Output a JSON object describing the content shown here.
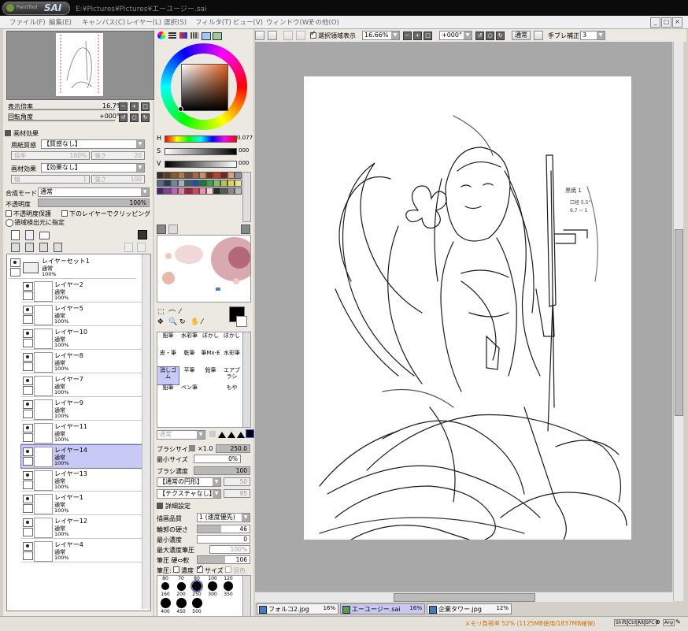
{
  "titlebar": {
    "logo_small": "PaintTool",
    "logo_text": "SAI",
    "path": "E:¥Pictures¥Pictures¥エーユージー.sai"
  },
  "menu": [
    "ファイル(F)",
    "編集(E)",
    "キャンバス(C)",
    "レイヤー(L)",
    "選択(S)",
    "フィルタ(T)",
    "ビュー(V)",
    "ウィンドウ(W)",
    "その他(O)"
  ],
  "window_buttons": [
    "_",
    "□",
    "×"
  ],
  "navigator": {
    "zoom_label": "表示倍率",
    "zoom_value": "16.7%",
    "rotation_label": "回転角度",
    "rotation_value": "+000°"
  },
  "paper_effects": {
    "header": "画材効果",
    "texture_label": "用紙質感",
    "texture_value": "【質感なし】",
    "texture_scale_label": "倍率",
    "texture_scale_value": "100%",
    "texture_strength_label": "強さ",
    "texture_strength_value": "20",
    "effect_label": "画材効果",
    "effect_value": "【効果なし】",
    "effect_width_label": "幅",
    "effect_width_value": "1",
    "effect_strength_label": "強さ",
    "effect_strength_value": "100"
  },
  "layer_settings": {
    "blend_label": "合成モード",
    "blend_value": "通常",
    "opacity_label": "不透明度",
    "opacity_value": "100%",
    "preserve_opacity": "不透明度保護",
    "clip_lower": "下のレイヤーでクリッピング",
    "selection_source": "領域検出元に指定"
  },
  "layers": [
    {
      "name": "レイヤーセット1",
      "mode": "通常",
      "opacity": "100%",
      "folder": true,
      "visible": true,
      "selected": false
    },
    {
      "name": "レイヤー2",
      "mode": "通常",
      "opacity": "100%",
      "visible": true,
      "selected": false
    },
    {
      "name": "レイヤー5",
      "mode": "通常",
      "opacity": "100%",
      "visible": true,
      "selected": false
    },
    {
      "name": "レイヤー10",
      "mode": "通常",
      "opacity": "100%",
      "visible": true,
      "selected": false
    },
    {
      "name": "レイヤー8",
      "mode": "通常",
      "opacity": "100%",
      "visible": true,
      "selected": false
    },
    {
      "name": "レイヤー7",
      "mode": "通常",
      "opacity": "100%",
      "visible": true,
      "selected": false
    },
    {
      "name": "レイヤー9",
      "mode": "通常",
      "opacity": "100%",
      "visible": true,
      "selected": false
    },
    {
      "name": "レイヤー11",
      "mode": "通常",
      "opacity": "100%",
      "visible": false,
      "selected": false
    },
    {
      "name": "レイヤー14",
      "mode": "通常",
      "opacity": "100%",
      "visible": true,
      "selected": true
    },
    {
      "name": "レイヤー13",
      "mode": "通常",
      "opacity": "100%",
      "visible": true,
      "selected": false
    },
    {
      "name": "レイヤー1",
      "mode": "通常",
      "opacity": "100%",
      "visible": false,
      "selected": false
    },
    {
      "name": "レイヤー12",
      "mode": "通常",
      "opacity": "100%",
      "visible": false,
      "selected": false
    },
    {
      "name": "レイヤー4",
      "mode": "通常",
      "opacity": "100%",
      "visible": true,
      "selected": false
    }
  ],
  "color": {
    "h_label": "H",
    "h_value": "0.077",
    "s_label": "S",
    "s_value": "000",
    "v_label": "V",
    "v_value": "000"
  },
  "swatches": [
    "#3a2a1f",
    "#5a3a22",
    "#8a5a2a",
    "#b07a3a",
    "#6a4a3a",
    "#a06a4a",
    "#c89060",
    "#7a2a1a",
    "#c04020",
    "#802020",
    "#e0a080",
    "#9090a0",
    "#5a6a8a",
    "#2a3a5a",
    "#6a8aa0",
    "#a0b0c0",
    "#3a5a7a",
    "#2050a0",
    "#1a7a3a",
    "#40a050",
    "#80c070",
    "#c0c040",
    "#e0d060",
    "#f0e090",
    "#502070",
    "#8040a0",
    "#c060c0",
    "#e080a0",
    "#a02040",
    "#e04060",
    "#f090b0",
    "#ffd0d0",
    "#2a2a2a",
    "#5a5a5a",
    "#8a8a8a",
    "#bababa"
  ],
  "tools": [
    {
      "label": "鉛筆"
    },
    {
      "label": "水彩筆"
    },
    {
      "label": "ぼかし"
    },
    {
      "label": "消しゴム"
    },
    {
      "label": "筆"
    },
    {
      "label": "鉛筆"
    },
    {
      "label": "エアブラシ"
    },
    {
      "label": "鉛筆"
    },
    {
      "label": "ペン"
    },
    {
      "label": "もや"
    }
  ],
  "tool_labels": {
    "row1": [
      "鉛筆",
      "水彩筆",
      "ぼかし",
      "ぼかし"
    ],
    "row2": [
      "皮・筆",
      "乾筆",
      "筆Mx-E",
      "水彩筆"
    ],
    "row3": [
      "消しゴム",
      "平筆",
      "鉛筆",
      "エアブラシ"
    ],
    "row4": [
      "鉛筆",
      "ペン筆",
      "",
      "もや"
    ]
  },
  "brush": {
    "mode": "通常",
    "size_label": "ブラシサイズ",
    "size_multiplier": "×1.0",
    "size_value": "250.0",
    "min_size_label": "最小サイズ",
    "min_size_value": "0%",
    "density_label": "ブラシ濃度",
    "density_value": "100",
    "shape_value": "【通常の円形】",
    "shape_amount": "50",
    "texture_value": "【テクスチャなし】",
    "texture_amount": "95",
    "detail_header": "詳細設定",
    "quality_label": "描画品質",
    "quality_value": "1 (速度優先)",
    "edge_label": "輪郭の硬さ",
    "edge_value": "46",
    "min_density_label": "最小濃度",
    "min_density_value": "0",
    "max_density_pressure_label": "最大濃度筆圧",
    "max_density_pressure_value": "100%",
    "pressure_label": "筆圧 硬⇔軟",
    "pressure_value": "106",
    "pressure_opts_label": "筆圧:",
    "pressure_density": "濃度",
    "pressure_size": "サイズ",
    "pressure_blend": "混色",
    "size_presets_top": [
      "80",
      "70",
      "80",
      "100",
      "120"
    ],
    "size_presets_mid": [
      "160",
      "200",
      "250",
      "300",
      "350"
    ],
    "size_presets_bot": [
      "400",
      "450",
      "500"
    ]
  },
  "canvas_toolbar": {
    "show_selection": "選択領域表示",
    "zoom": "16.66%",
    "rotation": "+000°",
    "mode": "通常",
    "stabilizer_label": "手ブレ補正",
    "stabilizer_value": "3"
  },
  "sketch_notes": [
    "黒焼 1",
    "口径 5.5\"",
    "6.7 ~ 1"
  ],
  "tabs": [
    {
      "name": "フォルコ2.jpg",
      "pct": "16%",
      "active": false
    },
    {
      "name": "エーユージー.sai",
      "pct": "16%",
      "active": true
    },
    {
      "name": "企業タワー.jpg",
      "pct": "12%",
      "active": false
    }
  ],
  "status": {
    "memory": "メモリ負荷率 52% (1125MB使用/1837MB確保)",
    "keys": [
      "Shift",
      "Ctrl",
      "Alt",
      "SPC",
      "Any"
    ]
  }
}
